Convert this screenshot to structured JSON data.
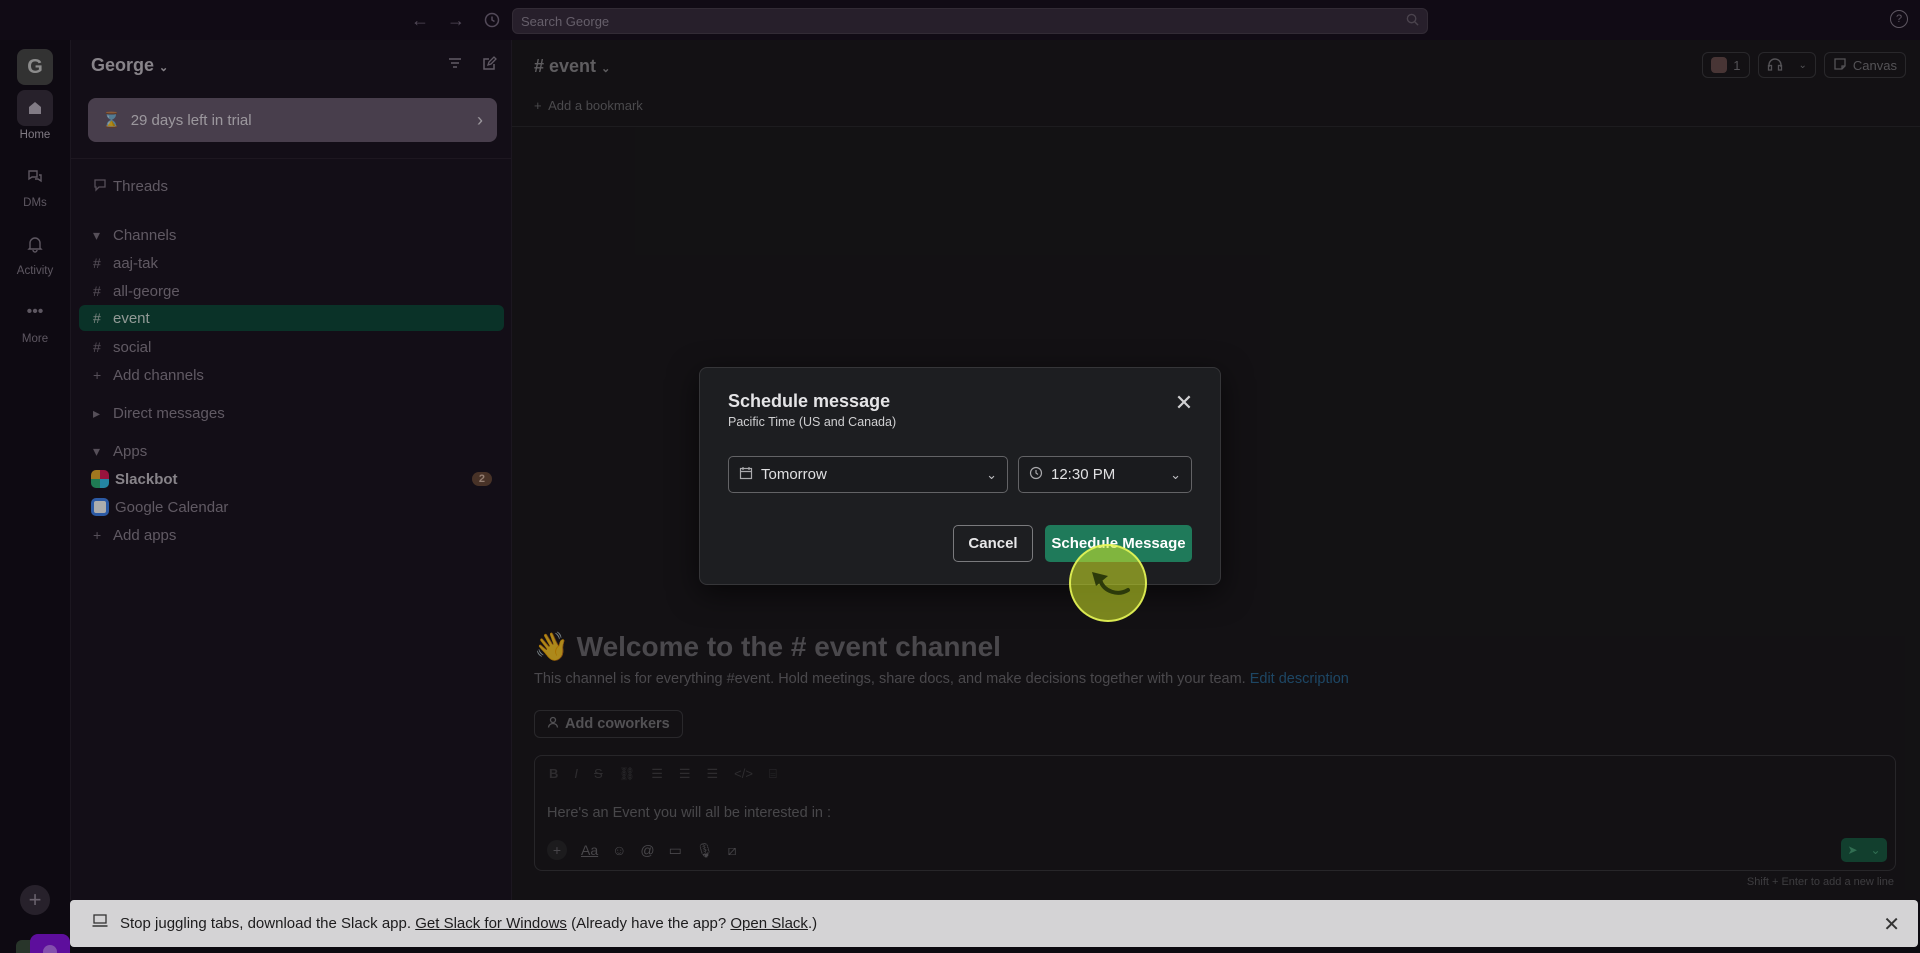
{
  "search": {
    "placeholder": "Search George"
  },
  "rail": {
    "workspace_initial": "G",
    "items": [
      {
        "label": "Home"
      },
      {
        "label": "DMs"
      },
      {
        "label": "Activity"
      },
      {
        "label": "More"
      }
    ]
  },
  "sidebar": {
    "workspace_name": "George",
    "trial_text": "29 days left in trial",
    "threads": "Threads",
    "channels_header": "Channels",
    "channels": [
      {
        "name": "aaj-tak"
      },
      {
        "name": "all-george"
      },
      {
        "name": "event"
      },
      {
        "name": "social"
      }
    ],
    "add_channels": "Add channels",
    "direct_messages": "Direct messages",
    "apps_header": "Apps",
    "apps": [
      {
        "name": "Slackbot",
        "badge": "2"
      },
      {
        "name": "Google Calendar"
      }
    ],
    "add_apps": "Add apps"
  },
  "main": {
    "channel_title": "event",
    "bookmark": "Add a bookmark",
    "member_count": "1",
    "canvas": "Canvas",
    "welcome_emoji": "👋",
    "welcome_pre": "Welcome to the",
    "welcome_channel": "event channel",
    "welcome_desc": "This channel is for everything #event. Hold meetings, share docs, and make decisions together with your team.",
    "edit_description": "Edit description",
    "add_coworkers": "Add coworkers",
    "composer_text": "Here's an Event you will all be interested in :",
    "hint": "Shift + Enter to add a new line"
  },
  "modal": {
    "title": "Schedule message",
    "subtitle": "Pacific Time (US and Canada)",
    "date_value": "Tomorrow",
    "time_value": "12:30 PM",
    "cancel": "Cancel",
    "schedule": "Schedule Message"
  },
  "banner": {
    "text": "Stop juggling tabs, download the Slack app.",
    "link1": "Get Slack for Windows",
    "mid": "(Already have the app?",
    "link2": "Open Slack",
    "end": ".)"
  },
  "colors": {
    "accent": "#1f7a5a",
    "active_channel": "#104a3b",
    "highlight": "#cfe628"
  }
}
